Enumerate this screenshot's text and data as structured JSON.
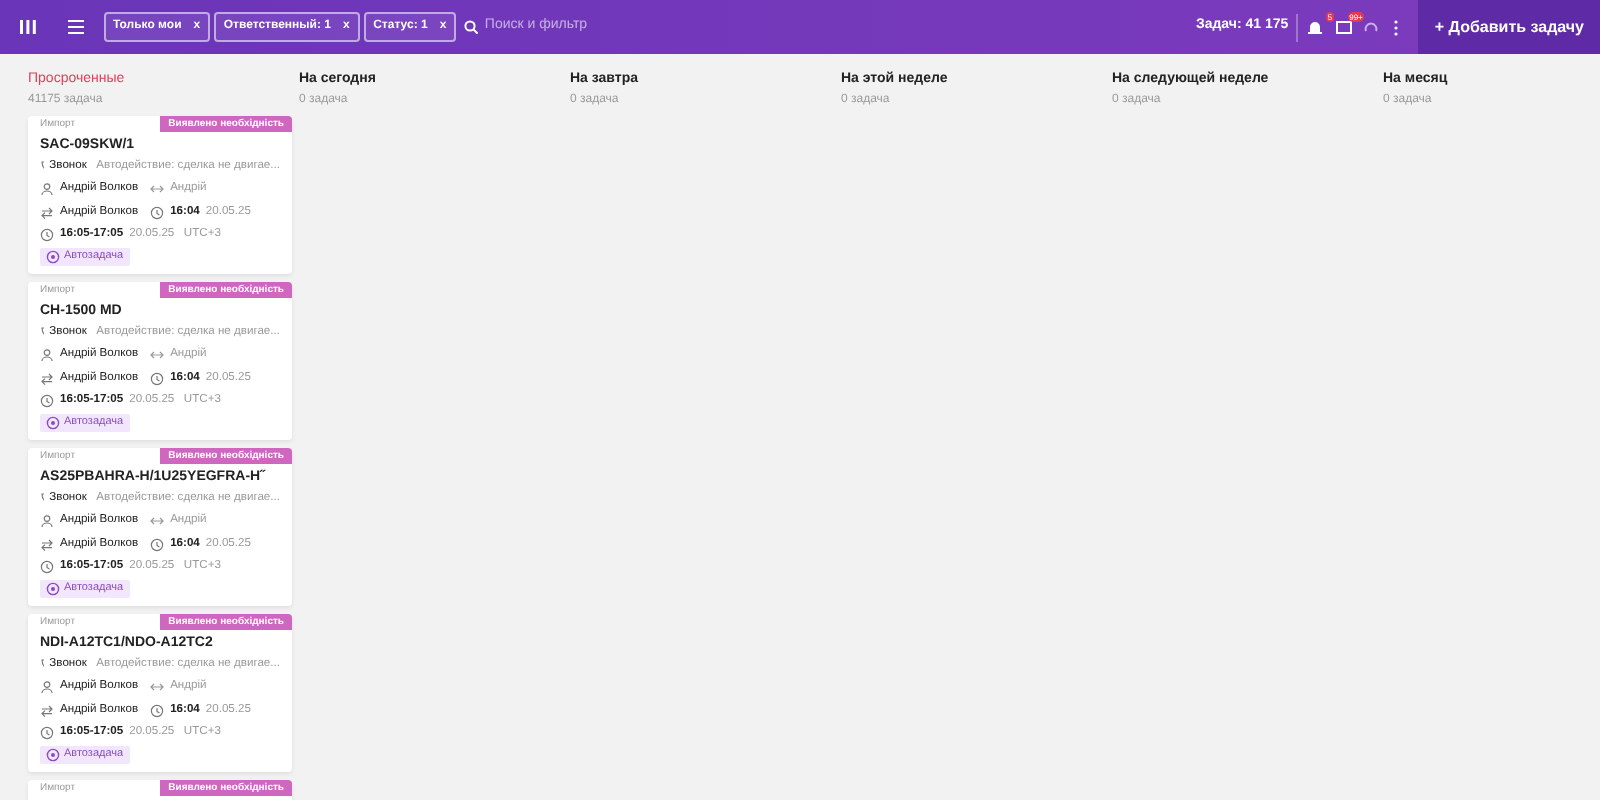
{
  "header": {
    "filters": [
      {
        "label": "Только мои",
        "close": "x"
      },
      {
        "label": "Ответственный: 1",
        "close": "x"
      },
      {
        "label": "Статус: 1",
        "close": "x"
      }
    ],
    "search": {
      "placeholder": "Поиск и фильтр"
    },
    "task_count": "Задач: 41 175",
    "bell_badge": "5",
    "inbox_badge": "99+",
    "add_button": "+ Добавить задачу"
  },
  "columns": [
    {
      "title": "Просроченные",
      "overdue": true,
      "count": "41175 задача",
      "cards": [
        {
          "source": "Импорт",
          "badge": "Виявлено необхідність",
          "title": "SAC-09SKW/1",
          "type": "Звонок",
          "note": "Автодействие: сделка не двигае...",
          "owner": "Андрій Волков",
          "assignee": "Андрій",
          "creator": "Андрій Волков",
          "time": "16:04",
          "date": "20.05.25",
          "range": "16:05-17:05",
          "range_date": "20.05.25",
          "tz": "UTC+3",
          "tag": "Автозадача"
        },
        {
          "source": "Импорт",
          "badge": "Виявлено необхідність",
          "title": "CH-1500 MD",
          "type": "Звонок",
          "note": "Автодействие: сделка не двигае...",
          "owner": "Андрій Волков",
          "assignee": "Андрій",
          "creator": "Андрій Волков",
          "time": "16:04",
          "date": "20.05.25",
          "range": "16:05-17:05",
          "range_date": "20.05.25",
          "tz": "UTC+3",
          "tag": "Автозадача"
        },
        {
          "source": "Импорт",
          "badge": "Виявлено необхідність",
          "title": "AS25PBAHRA-H/1U25YEGFRA-H˝",
          "type": "Звонок",
          "note": "Автодействие: сделка не двигае...",
          "owner": "Андрій Волков",
          "assignee": "Андрій",
          "creator": "Андрій Волков",
          "time": "16:04",
          "date": "20.05.25",
          "range": "16:05-17:05",
          "range_date": "20.05.25",
          "tz": "UTC+3",
          "tag": "Автозадача"
        },
        {
          "source": "Импорт",
          "badge": "Виявлено необхідність",
          "title": "NDI-A12TC1/NDO-A12TC2",
          "type": "Звонок",
          "note": "Автодействие: сделка не двигае...",
          "owner": "Андрій Волков",
          "assignee": "Андрій",
          "creator": "Андрій Волков",
          "time": "16:04",
          "date": "20.05.25",
          "range": "16:05-17:05",
          "range_date": "20.05.25",
          "tz": "UTC+3",
          "tag": "Автозадача"
        },
        {
          "source": "Импорт",
          "badge": "Виявлено необхідність"
        }
      ]
    },
    {
      "title": "На сегодня",
      "overdue": false,
      "count": "0 задача"
    },
    {
      "title": "На завтра",
      "overdue": false,
      "count": "0 задача"
    },
    {
      "title": "На этой неделе",
      "overdue": false,
      "count": "0 задача"
    },
    {
      "title": "На следующей неделе",
      "overdue": false,
      "count": "0 задача"
    },
    {
      "title": "На месяц",
      "overdue": false,
      "count": "0 задача"
    }
  ]
}
